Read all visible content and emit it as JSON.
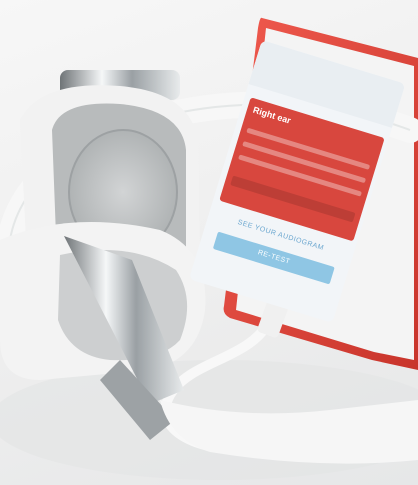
{
  "photo": {
    "subject": "headphones-and-smartphone",
    "colors": {
      "phone_body": "#e8443a",
      "headphone": "#f4f4f4",
      "cushion": "#b9bcbd",
      "table": "#eef0f1"
    }
  },
  "phone_screen": {
    "card_title": "Right ear",
    "link_text": "SEE YOUR AUDIOGRAM",
    "button_label": "RE-TEST"
  }
}
